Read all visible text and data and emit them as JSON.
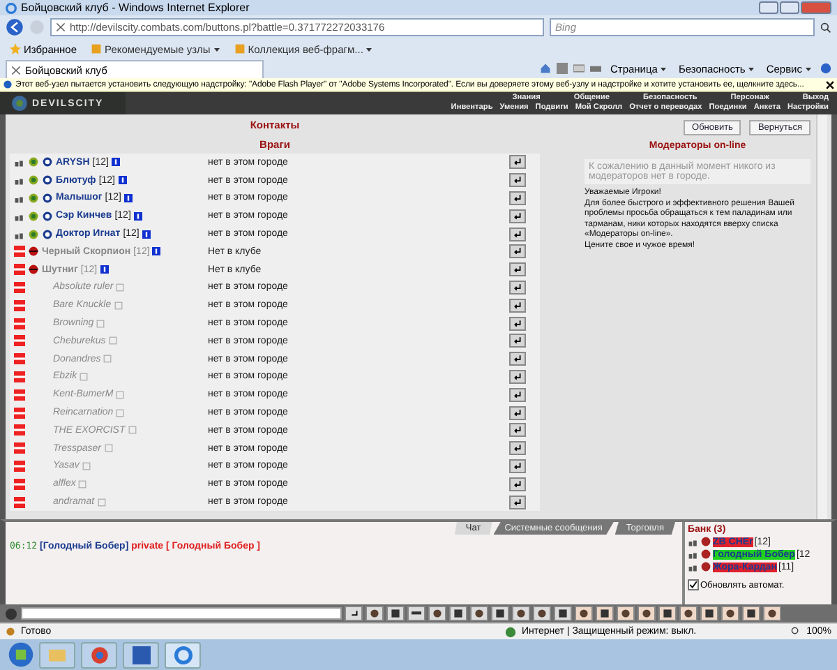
{
  "window": {
    "title": "Бойцовский клуб - Windows Internet Explorer"
  },
  "browser": {
    "address": "http://devilscity.combats.com/buttons.pl?battle=0.371772272033176",
    "search_placeholder": "Bing",
    "favorites": [
      {
        "label": "Избранное",
        "kind": "star"
      },
      {
        "label": "Рекомендуемые узлы",
        "kind": "dropdown"
      },
      {
        "label": "Коллекция веб-фрагм...",
        "kind": "dropdown"
      }
    ],
    "tab": "Бойцовский клуб",
    "commands": [
      "Страница",
      "Безопасность",
      "Сервис"
    ],
    "info_bar": "Этот веб-узел пытается установить следующую надстройку: \"Adobe Flash Player\" от \"Adobe Systems Incorporated\". Если вы доверяете этому веб-узлу и надстройке и хотите установить ее, щелкните здесь..."
  },
  "game": {
    "logo": "DEVILSCITY",
    "nav_top": [
      "Знания",
      "Общение",
      "Безопасность",
      "Персонаж",
      "Выход"
    ],
    "nav_bottom": [
      "Инвентарь",
      "Умения",
      "Подвиги",
      "Мой Скролл",
      "Отчет о переводах",
      "Поединки",
      "Анкета",
      "Настройки"
    ]
  },
  "contacts": {
    "title": "Контакты",
    "section": "Враги",
    "rows": [
      {
        "kind": "clan",
        "name": "ARYSH",
        "level": "[12]",
        "status": "нет в этом городе"
      },
      {
        "kind": "clan",
        "name": "Блютуф",
        "level": "[12]",
        "status": "нет в этом городе"
      },
      {
        "kind": "clan",
        "name": "Малышог",
        "level": "[12]",
        "status": "нет в этом городе"
      },
      {
        "kind": "clan",
        "name": "Сэр Кинчев",
        "level": "[12]",
        "status": "нет в этом городе"
      },
      {
        "kind": "clan",
        "name": "Доктор Игнат",
        "level": "[12]",
        "status": "нет в этом городе"
      },
      {
        "kind": "exiled",
        "name": "Черный Скорпион",
        "level": "[12]",
        "status": "Нет в клубе"
      },
      {
        "kind": "exiled",
        "name": "Шутниг",
        "level": "[12]",
        "status": "Нет в клубе"
      },
      {
        "kind": "absent",
        "name": "Absolute ruler",
        "status": "нет в этом городе"
      },
      {
        "kind": "absent",
        "name": "Bare Knuckle",
        "status": "нет в этом городе"
      },
      {
        "kind": "absent",
        "name": "Browning",
        "status": "нет в этом городе"
      },
      {
        "kind": "absent",
        "name": "Cheburekus",
        "status": "нет в этом городе"
      },
      {
        "kind": "absent",
        "name": "Donandres",
        "status": "нет в этом городе"
      },
      {
        "kind": "absent",
        "name": "Ebzik",
        "status": "нет в этом городе"
      },
      {
        "kind": "absent",
        "name": "Kent-BumerM",
        "status": "нет в этом городе"
      },
      {
        "kind": "absent",
        "name": "Reincarnation",
        "status": "нет в этом городе"
      },
      {
        "kind": "absent",
        "name": "THE EXORCIST",
        "status": "нет в этом городе"
      },
      {
        "kind": "absent",
        "name": "Tresspaser",
        "status": "нет в этом городе"
      },
      {
        "kind": "absent",
        "name": "Yasav",
        "status": "нет в этом городе"
      },
      {
        "kind": "absent",
        "name": "alflex",
        "status": "нет в этом городе"
      },
      {
        "kind": "absent",
        "name": "andramat",
        "status": "нет в этом городе"
      }
    ]
  },
  "moderators": {
    "buttons": [
      "Обновить",
      "Вернуться"
    ],
    "title": "Модераторы on-line",
    "notice": "К сожалению в данный момент никого из модераторов нет в городе.",
    "message": "Уважаемые Игроки!\nДля более быстрого и эффективного решения Вашей проблемы просьба обращаться к тем паладинам или тарманам, ники которых находятся вверху списка «Модераторы on-line».\nЦените свое и чужое время!"
  },
  "chat": {
    "tabs": [
      {
        "label": "Чат",
        "selected": true
      },
      {
        "label": "Системные сообщения",
        "selected": false
      },
      {
        "label": "Торговля",
        "selected": false
      }
    ],
    "messages": [
      {
        "time": "06:12",
        "sender": "[Голодный Бобер]",
        "text": "private [ Голодный Бобер ]"
      }
    ],
    "room": {
      "title": "Банк (3)",
      "people": [
        {
          "name": "ZB CHEr",
          "level": "[12]",
          "color": "#e0202a"
        },
        {
          "name": "Голодный Бобер",
          "level": "[12",
          "color": "#20d020"
        },
        {
          "name": "Жора-Кардан",
          "level": "[11]",
          "color": "#e0202a"
        }
      ],
      "auto_refresh": {
        "label": "Обновлять автомат.",
        "checked": true
      }
    }
  },
  "status_bar": {
    "text": "Готово",
    "zone": "Интернет | Защищенный режим: выкл.",
    "zoom": "100%"
  }
}
